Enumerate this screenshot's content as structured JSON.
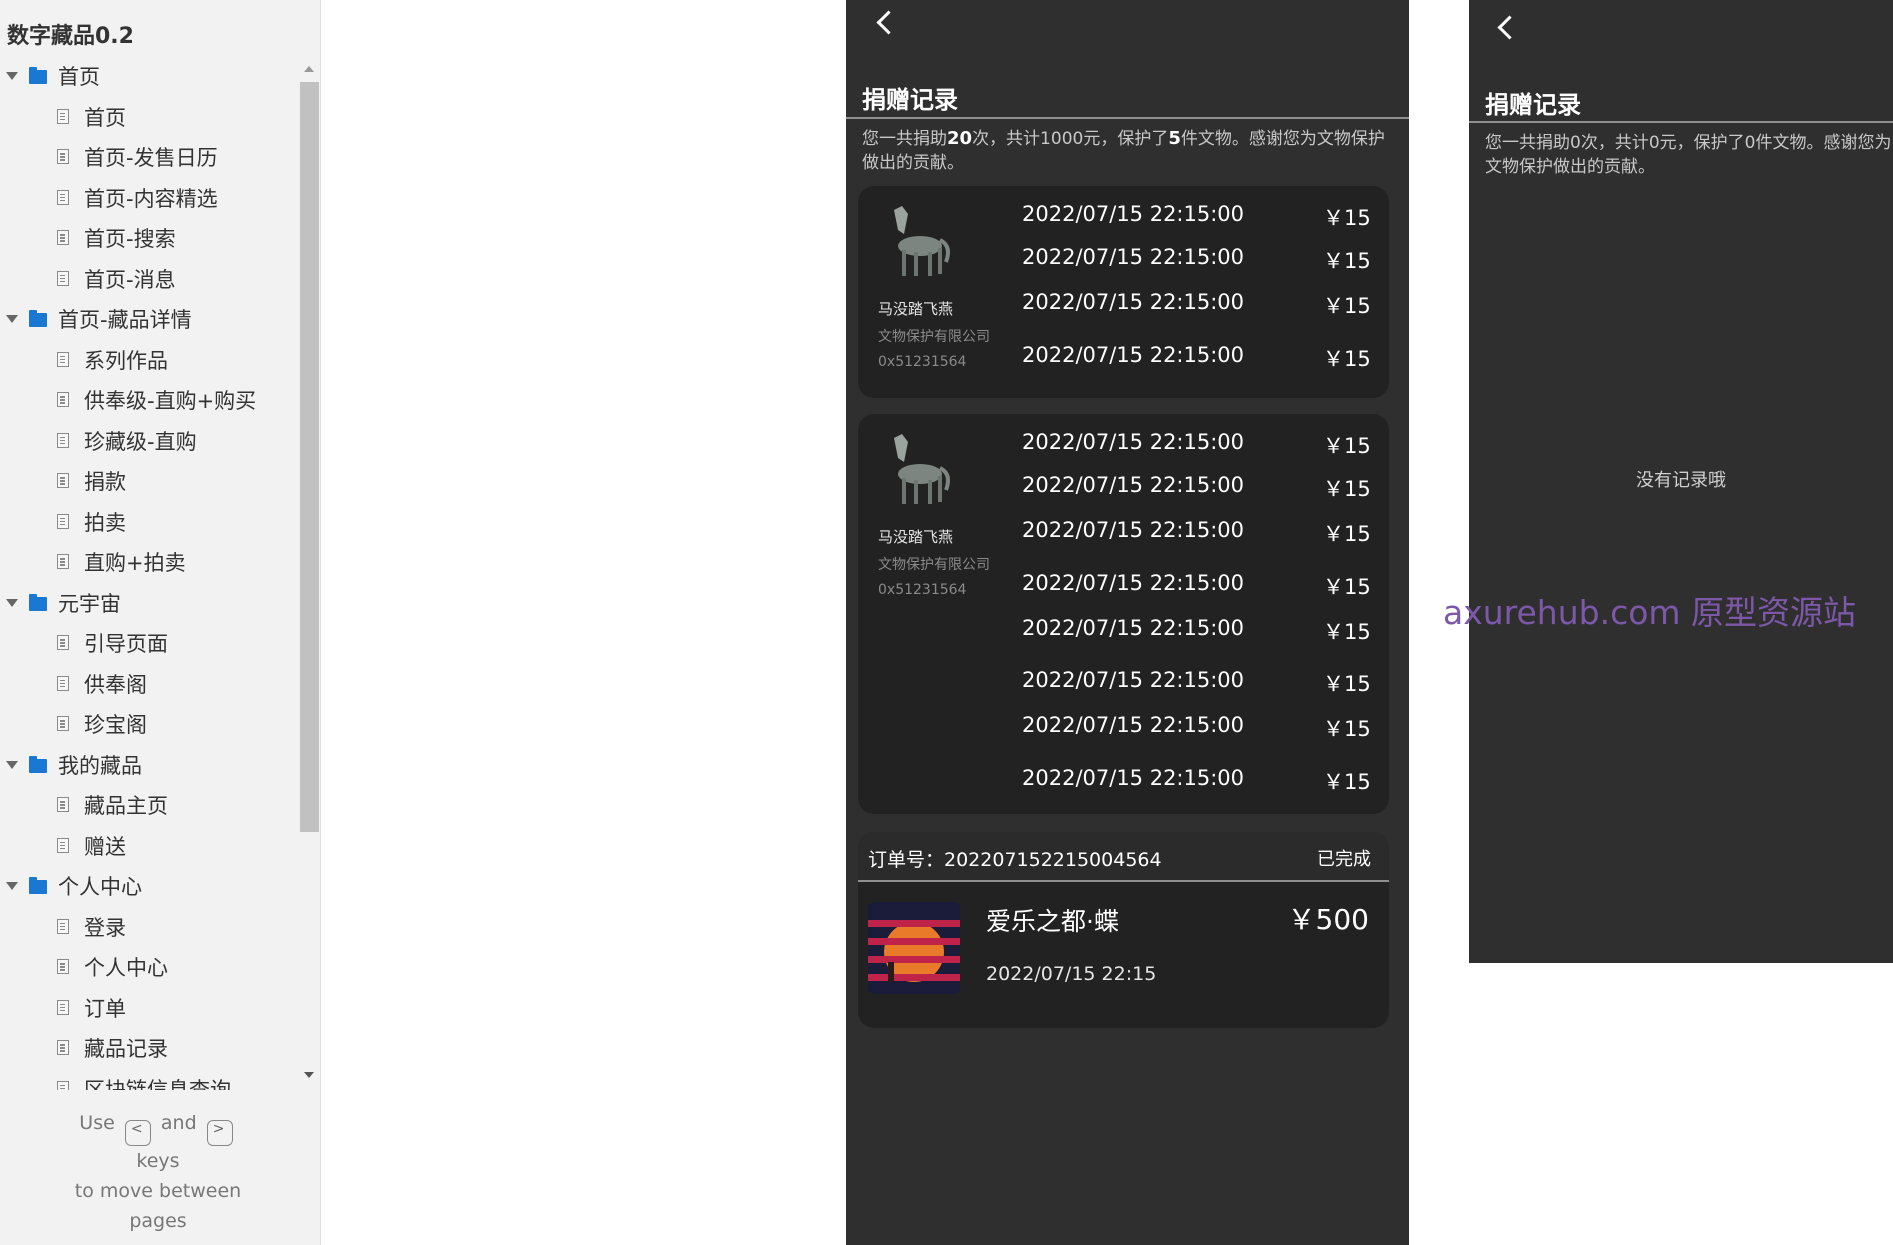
{
  "sidebar": {
    "project_title": "数字藏品0.2",
    "tree": [
      {
        "type": "folder",
        "label": "首页"
      },
      {
        "type": "page",
        "label": "首页"
      },
      {
        "type": "page",
        "label": "首页-发售日历"
      },
      {
        "type": "page",
        "label": "首页-内容精选"
      },
      {
        "type": "page",
        "label": "首页-搜索"
      },
      {
        "type": "page",
        "label": "首页-消息"
      },
      {
        "type": "folder",
        "label": "首页-藏品详情"
      },
      {
        "type": "page",
        "label": "系列作品"
      },
      {
        "type": "page",
        "label": "供奉级-直购+购买"
      },
      {
        "type": "page",
        "label": "珍藏级-直购"
      },
      {
        "type": "page",
        "label": "捐款"
      },
      {
        "type": "page",
        "label": "拍卖"
      },
      {
        "type": "page",
        "label": "直购+拍卖"
      },
      {
        "type": "folder",
        "label": "元宇宙"
      },
      {
        "type": "page",
        "label": "引导页面"
      },
      {
        "type": "page",
        "label": "供奉阁"
      },
      {
        "type": "page",
        "label": "珍宝阁"
      },
      {
        "type": "folder",
        "label": "我的藏品"
      },
      {
        "type": "page",
        "label": "藏品主页"
      },
      {
        "type": "page",
        "label": "赠送"
      },
      {
        "type": "folder",
        "label": "个人中心"
      },
      {
        "type": "page",
        "label": "登录"
      },
      {
        "type": "page",
        "label": "个人中心"
      },
      {
        "type": "page",
        "label": "订单"
      },
      {
        "type": "page",
        "label": "藏品记录"
      },
      {
        "type": "page",
        "label": "区块链信息查询"
      }
    ],
    "help": {
      "use": "Use",
      "and": "and",
      "keys": "keys",
      "move": "to move between",
      "pages": "pages",
      "prev_key": "<",
      "next_key": ">"
    }
  },
  "screen_a": {
    "title": "捐赠记录",
    "summary_parts": [
      "您一共捐助",
      "20",
      "次，共计1000元，保护了",
      "5",
      "件文物。感谢您为文物保护做出的贡献。"
    ],
    "cards": [
      {
        "name": "马没踏飞燕",
        "org": "文物保护有限公司",
        "addr": "0x51231564",
        "records": [
          {
            "time": "2022/07/15 22:15:00",
            "amount": "￥15"
          },
          {
            "time": "2022/07/15 22:15:00",
            "amount": "￥15"
          },
          {
            "time": "2022/07/15 22:15:00",
            "amount": "￥15"
          },
          {
            "time": "2022/07/15 22:15:00",
            "amount": "￥15"
          }
        ]
      },
      {
        "name": "马没踏飞燕",
        "org": "文物保护有限公司",
        "addr": "0x51231564",
        "records": [
          {
            "time": "2022/07/15 22:15:00",
            "amount": "￥15"
          },
          {
            "time": "2022/07/15 22:15:00",
            "amount": "￥15"
          },
          {
            "time": "2022/07/15 22:15:00",
            "amount": "￥15"
          },
          {
            "time": "2022/07/15 22:15:00",
            "amount": "￥15"
          },
          {
            "time": "2022/07/15 22:15:00",
            "amount": "￥15"
          },
          {
            "time": "2022/07/15 22:15:00",
            "amount": "￥15"
          },
          {
            "time": "2022/07/15 22:15:00",
            "amount": "￥15"
          },
          {
            "time": "2022/07/15 22:15:00",
            "amount": "￥15"
          }
        ]
      }
    ],
    "order": {
      "number": "订单号：202207152215004564",
      "status": "已完成",
      "name": "爱乐之都·蝶",
      "price": "￥500",
      "date": "2022/07/15 22:15"
    }
  },
  "screen_b": {
    "title": "捐赠记录",
    "summary": "您一共捐助0次，共计0元，保护了0件文物。感谢您为文物保护做出的贡献。",
    "empty_text": "没有记录哦"
  },
  "watermark": "axurehub.com 原型资源站",
  "colors": {
    "screen_bg": "#2f2f2f",
    "card_bg": "#222222",
    "sidebar_bg": "#f2f2f2",
    "folder_blue": "#1a78d2",
    "watermark": "#7d58a8"
  }
}
